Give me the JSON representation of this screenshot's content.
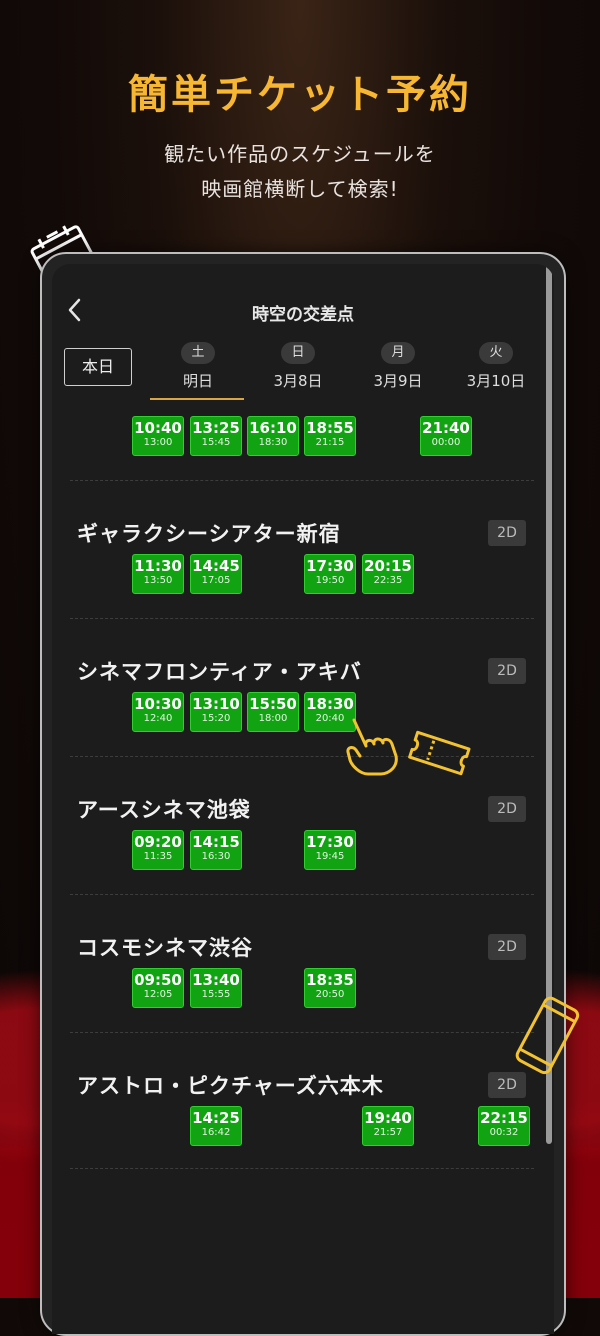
{
  "promo": {
    "headline": "簡単チケット予約",
    "subline1": "観たい作品のスケジュールを",
    "subline2": "映画館横断して検索!"
  },
  "app": {
    "back_icon": "chevron-left-icon",
    "title": "時空の交差点",
    "today_label": "本日",
    "day_tabs": [
      {
        "badge": "土",
        "label": "明日",
        "selected": true
      },
      {
        "badge": "日",
        "label": "3月8日"
      },
      {
        "badge": "月",
        "label": "3月9日"
      },
      {
        "badge": "火",
        "label": "3月10日"
      }
    ],
    "theaters": [
      {
        "name": "",
        "format": "",
        "times": [
          {
            "start": "10:40",
            "end": "13:00"
          },
          {
            "start": "13:25",
            "end": "15:45"
          },
          {
            "start": "16:10",
            "end": "18:30"
          },
          {
            "start": "18:55",
            "end": "21:15"
          },
          {
            "start": "21:40",
            "end": "00:00"
          }
        ]
      },
      {
        "name": "ギャラクシーシアター新宿",
        "format": "2D",
        "times": [
          {
            "start": "11:30",
            "end": "13:50"
          },
          {
            "start": "14:45",
            "end": "17:05"
          },
          {
            "start": "17:30",
            "end": "19:50"
          },
          {
            "start": "20:15",
            "end": "22:35"
          }
        ]
      },
      {
        "name": "シネマフロンティア・アキバ",
        "format": "2D",
        "times": [
          {
            "start": "10:30",
            "end": "12:40"
          },
          {
            "start": "13:10",
            "end": "15:20"
          },
          {
            "start": "15:50",
            "end": "18:00"
          },
          {
            "start": "18:30",
            "end": "20:40"
          }
        ]
      },
      {
        "name": "アースシネマ池袋",
        "format": "2D",
        "times": [
          {
            "start": "09:20",
            "end": "11:35"
          },
          {
            "start": "14:15",
            "end": "16:30"
          },
          {
            "start": "17:30",
            "end": "19:45"
          }
        ]
      },
      {
        "name": "コスモシネマ渋谷",
        "format": "2D",
        "times": [
          {
            "start": "09:50",
            "end": "12:05"
          },
          {
            "start": "13:40",
            "end": "15:55"
          },
          {
            "start": "18:35",
            "end": "20:50"
          }
        ]
      },
      {
        "name": "アストロ・ピクチャーズ六本木",
        "format": "2D",
        "times": [
          {
            "start": "14:25",
            "end": "16:42"
          },
          {
            "start": "19:40",
            "end": "21:57"
          },
          {
            "start": "22:15",
            "end": "00:32"
          }
        ]
      }
    ]
  },
  "decorations": [
    "calendar-icon",
    "pointing-hand-icon",
    "ticket-icon",
    "smartphone-icon"
  ],
  "colors": {
    "headline": "#f7b733",
    "slot_fill": "#11a311",
    "slot_border": "#2ecf2e",
    "tab_underline": "#d8a643",
    "deco_stroke": "#f2c230"
  }
}
